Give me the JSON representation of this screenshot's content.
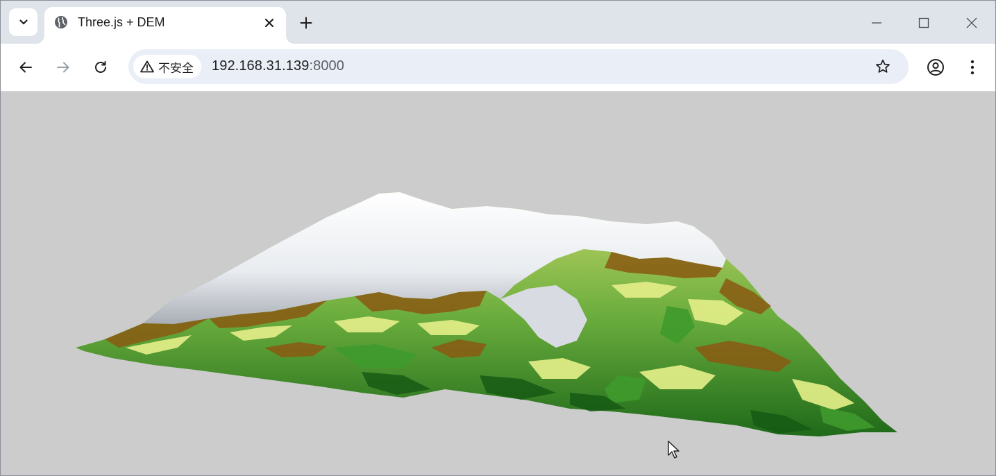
{
  "tab": {
    "title": "Three.js + DEM"
  },
  "address_bar": {
    "security_label": "不安全",
    "url_host": "192.168.31.139",
    "url_port": ":8000"
  },
  "icons": {
    "tab_search": "chevron-down-icon",
    "favicon": "globe-icon",
    "tab_close": "close-icon",
    "new_tab": "plus-icon",
    "minimize": "minimize-icon",
    "maximize": "maximize-icon",
    "close_window": "close-icon",
    "back": "arrow-left-icon",
    "forward": "arrow-right-icon",
    "reload": "reload-icon",
    "warning": "warning-icon",
    "bookmark": "star-icon",
    "profile": "account-icon",
    "menu": "more-vert-icon",
    "cursor": "mouse-pointer-icon"
  },
  "scene": {
    "background": "#cccccc",
    "terrain_colors": {
      "snow": "#f4f6f8",
      "rock": "#9aa0a8",
      "brown": "#8a5a12",
      "yellow_green": "#e6ef8a",
      "light_green": "#a9d36a",
      "green": "#3f9a2c",
      "dark_green": "#165a14"
    }
  }
}
